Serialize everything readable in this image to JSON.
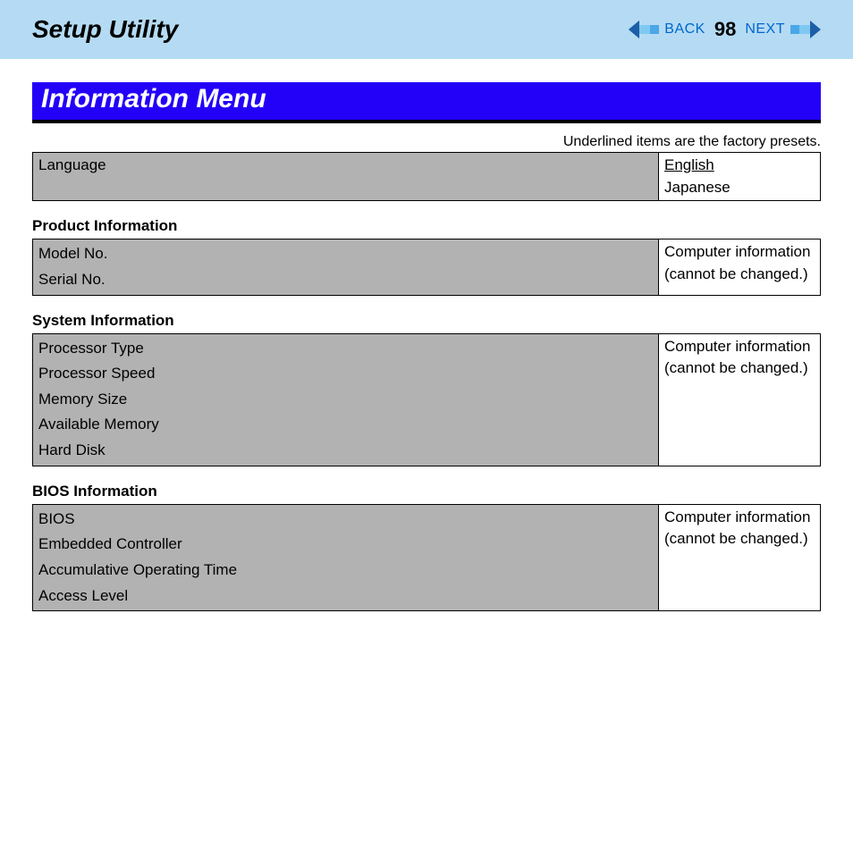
{
  "header": {
    "title": "Setup Utility",
    "back_label": "BACK",
    "next_label": "NEXT",
    "page_number": "98"
  },
  "section_title": "Information Menu",
  "preset_note": "Underlined items are the factory presets.",
  "language_row": {
    "label": "Language",
    "option_underlined": "English",
    "option_plain": "Japanese"
  },
  "readonly_note_line1": "Computer information",
  "readonly_note_line2": "(cannot be changed.)",
  "product_info": {
    "heading": "Product Information",
    "items": [
      "Model No.",
      "Serial No."
    ]
  },
  "system_info": {
    "heading": "System Information",
    "items": [
      "Processor Type",
      "Processor Speed",
      "Memory Size",
      "Available Memory",
      "Hard Disk"
    ]
  },
  "bios_info": {
    "heading": "BIOS Information",
    "items": [
      "BIOS",
      "Embedded Controller",
      "Accumulative Operating Time",
      "Access Level"
    ]
  }
}
